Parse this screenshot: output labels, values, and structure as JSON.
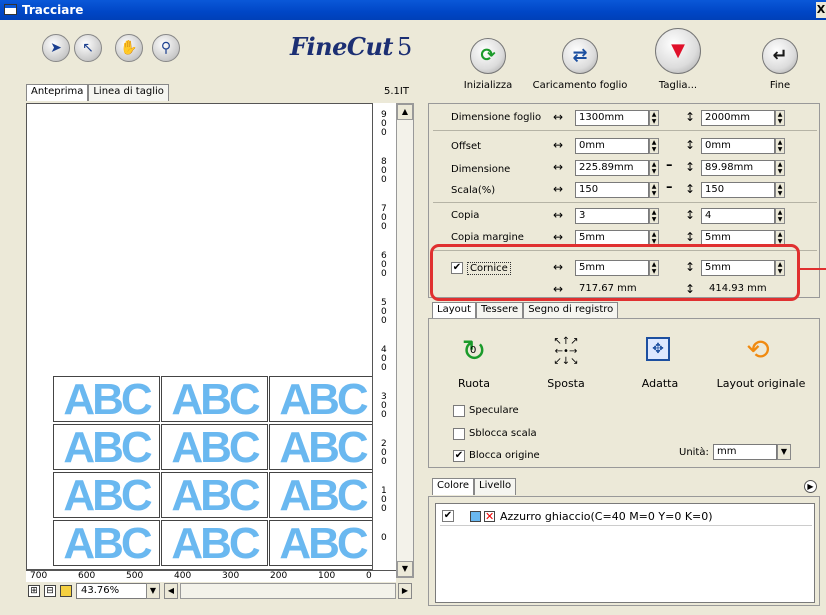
{
  "window": {
    "title": "Tracciare",
    "close": "X"
  },
  "toolbar": {
    "logo_main": "FineCut",
    "logo_version": "5",
    "tools": [
      "select-tool",
      "pointer-tool",
      "hand-tool",
      "zoom-tool"
    ]
  },
  "left_tabs": [
    {
      "label": "Anteprima",
      "active": true
    },
    {
      "label": "Linea di taglio",
      "active": false
    }
  ],
  "version": "5.1IT",
  "preview": {
    "cell_text": "ABC",
    "rows": 4,
    "cols": 3
  },
  "vruler_labels": [
    "9\n0\n0",
    "8\n0\n0",
    "7\n0\n0",
    "6\n0\n0",
    "5\n0\n0",
    "4\n0\n0",
    "3\n0\n0",
    "2\n0\n0",
    "1\n0\n0",
    "0"
  ],
  "hruler_labels": [
    "700",
    "600",
    "500",
    "400",
    "300",
    "200",
    "100",
    "0"
  ],
  "zoom": "43.76%",
  "top_buttons": [
    {
      "label": "Inizializza",
      "icon": "refresh-icon"
    },
    {
      "label": "Caricamento foglio",
      "icon": "swap-arrows-icon"
    },
    {
      "label": "Taglia...",
      "icon": "cutter-icon"
    },
    {
      "label": "Fine",
      "icon": "return-arrow-icon"
    }
  ],
  "sheet": {
    "label": "Dimensione foglio",
    "width": "1300mm",
    "height": "2000mm"
  },
  "offset": {
    "label": "Offset",
    "x": "0mm",
    "y": "0mm"
  },
  "dimension": {
    "label": "Dimensione",
    "x": "225.89mm",
    "y": "89.98mm"
  },
  "scale": {
    "label": "Scala(%)",
    "x": "150",
    "y": "150"
  },
  "copy": {
    "label": "Copia",
    "x": "3",
    "y": "4"
  },
  "copy_margin": {
    "label": "Copia margine",
    "x": "5mm",
    "y": "5mm"
  },
  "frame": {
    "label": "Cornice",
    "checked": true,
    "x": "5mm",
    "y": "5mm",
    "total_x": "717.67 mm",
    "total_y": "414.93 mm"
  },
  "layout_tabs": [
    {
      "label": "Layout",
      "active": true
    },
    {
      "label": "Tessere",
      "active": false
    },
    {
      "label": "Segno di registro",
      "active": false
    }
  ],
  "layout_actions": [
    {
      "label": "Ruota",
      "icon": "rotate-icon",
      "badge": "0"
    },
    {
      "label": "Sposta",
      "icon": "move-arrows-icon"
    },
    {
      "label": "Adatta",
      "icon": "fit-icon"
    },
    {
      "label": "Layout originale",
      "icon": "original-layout-icon"
    }
  ],
  "options": [
    {
      "label": "Speculare",
      "checked": false
    },
    {
      "label": "Sblocca scala",
      "checked": false
    },
    {
      "label": "Blocca origine",
      "checked": true
    }
  ],
  "unit": {
    "label": "Unità:",
    "value": "mm"
  },
  "color_tabs": [
    {
      "label": "Colore",
      "active": true
    },
    {
      "label": "Livello",
      "active": false
    }
  ],
  "color_items": [
    {
      "label": "Azzurro ghiaccio(C=40 M=0 Y=0 K=0)",
      "checked": true,
      "swatch": "#6ab8f0"
    }
  ]
}
